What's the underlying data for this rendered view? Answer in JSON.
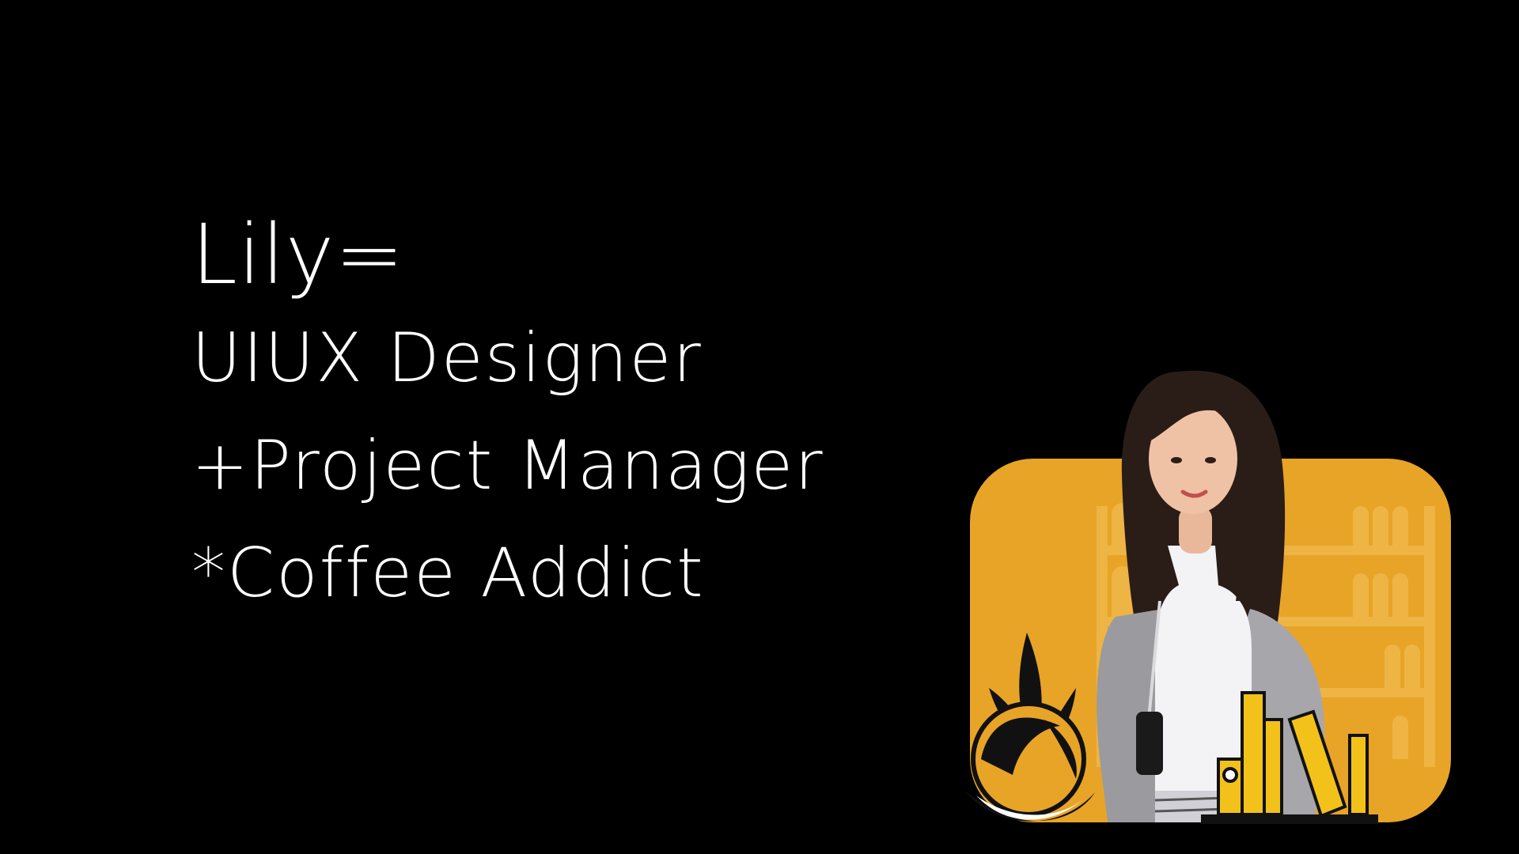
{
  "intro": {
    "name": "Lily=",
    "lines": [
      "UIUX Designer",
      "+Project Manager",
      "*Coffee Addict"
    ]
  },
  "colors": {
    "background": "#000000",
    "text": "#ffffff",
    "accent": "#E8A427",
    "shelf": "#F0B84A",
    "books": "#F2C21B"
  },
  "illustration": {
    "subject": "portrait-photo",
    "decor": [
      "bookshelf",
      "plant-pot",
      "books"
    ]
  }
}
